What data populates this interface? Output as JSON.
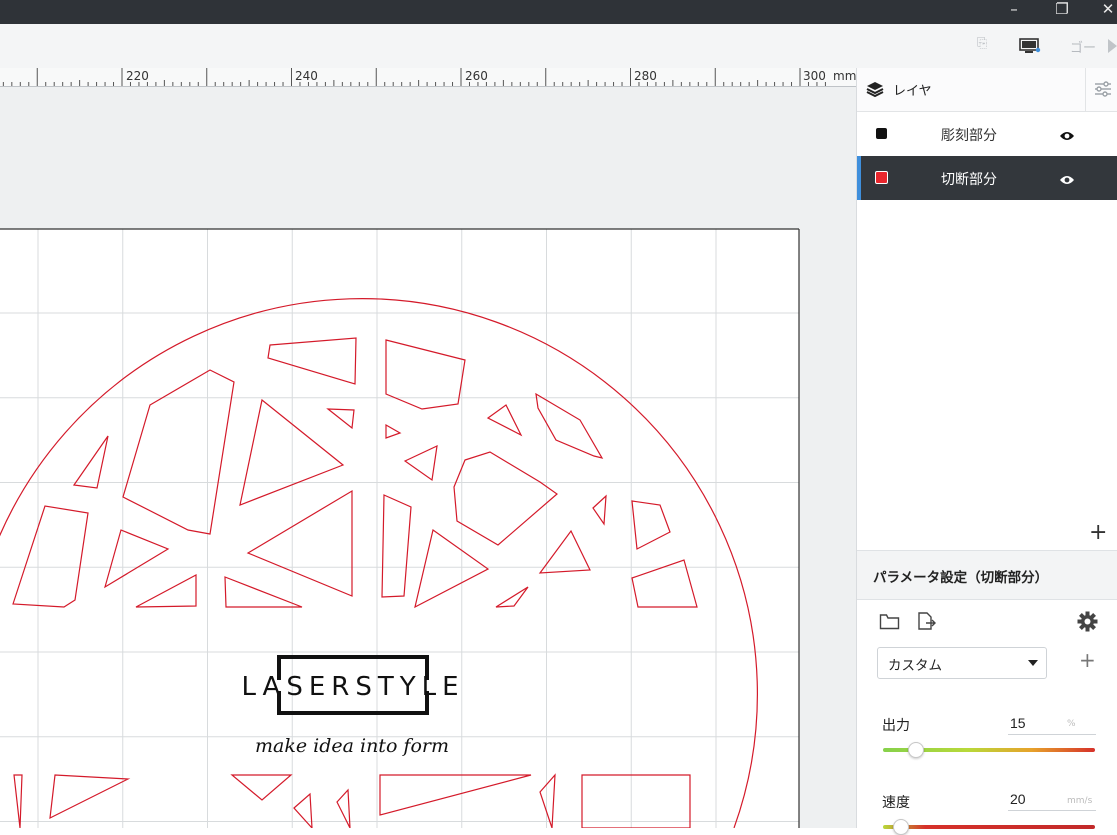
{
  "window": {
    "minimize_glyph": "–",
    "restore_glyph": "❐",
    "close_glyph": "✕"
  },
  "toolbar": {
    "go_label": "ゴー"
  },
  "ruler": {
    "labels": [
      "220",
      "240",
      "260",
      "280",
      "300"
    ],
    "unit": "mm"
  },
  "canvas": {
    "logo_text": "LASERSTYLE",
    "tagline": "make idea into form",
    "cut_color": "#d41a2a"
  },
  "layers": {
    "panel_title": "レイヤ",
    "items": [
      {
        "name": "彫刻部分",
        "color": "#111111",
        "visible": true,
        "active": false
      },
      {
        "name": "切断部分",
        "color": "#e8262d",
        "visible": true,
        "active": true
      }
    ]
  },
  "params": {
    "title": "パラメータ設定（切断部分）",
    "preset": "カスタム",
    "power": {
      "label": "出力",
      "value": "15",
      "unit": "%",
      "level": 0.15
    },
    "speed": {
      "label": "速度",
      "value": "20",
      "unit": "mm/s",
      "level": 0.08
    }
  },
  "icons": {
    "layers": "layers-stack-icon",
    "layer-settings": "sliders-icon",
    "eye": "eye-icon",
    "folder": "folder-icon",
    "export": "file-export-icon",
    "gear": "gear-icon",
    "add": "plus-icon"
  },
  "colors": {
    "titlebar": "#2f3338",
    "active_layer_bg": "#33373c",
    "accent": "#3f8fdc"
  }
}
